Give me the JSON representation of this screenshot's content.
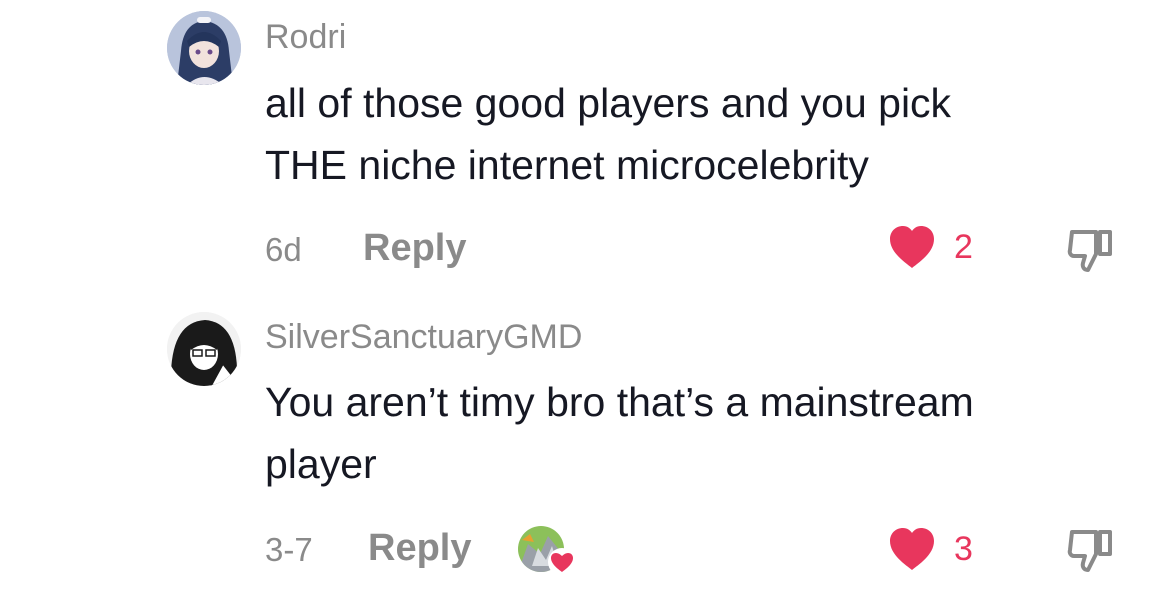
{
  "comments": [
    {
      "username": "Rodri",
      "text_line1": "all of those good players and you pick",
      "text_line2": "THE niche internet microcelebrity",
      "time": "6d",
      "reply_label": "Reply",
      "likes": "2",
      "avatar_icon": "anime-character-avatar"
    },
    {
      "username": "SilverSanctuaryGMD",
      "text_line1": "You aren’t timy bro that’s a mainstream",
      "text_line2": "player",
      "time": "3-7",
      "reply_label": "Reply",
      "likes": "3",
      "avatar_icon": "manga-character-avatar",
      "liked_by_creator_icon": "creator-liked-avatar"
    }
  ],
  "colors": {
    "like": "#e8365d",
    "muted": "#8a8a8a",
    "text": "#161823"
  },
  "icons": {
    "like": "heart-icon",
    "dislike": "thumbs-down-icon"
  }
}
